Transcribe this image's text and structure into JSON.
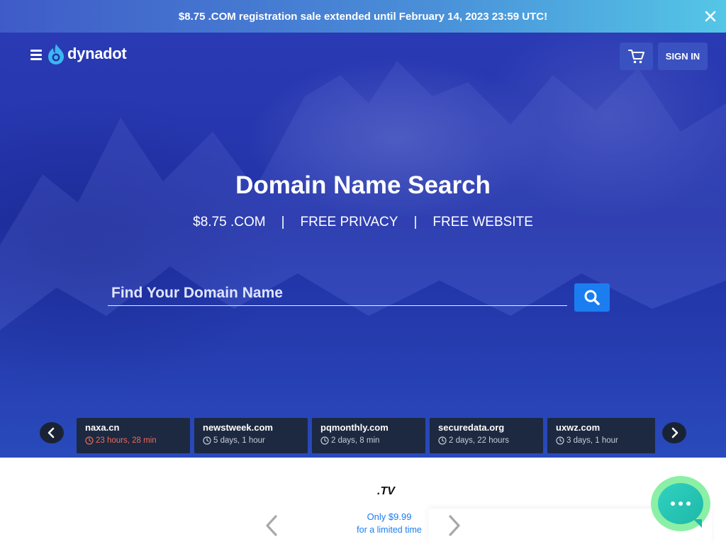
{
  "banner": {
    "text": "$8.75 .COM registration sale extended until February 14, 2023 23:59 UTC!"
  },
  "header": {
    "logo_text": "dynadot",
    "sign_in_label": "SIGN IN"
  },
  "hero": {
    "title": "Domain Name Search",
    "features": [
      "$8.75 .COM",
      "FREE PRIVACY",
      "FREE WEBSITE"
    ],
    "separator": "|",
    "search_placeholder": "Find Your Domain Name"
  },
  "auctions": [
    {
      "domain": "naxa.cn",
      "time": "23 hours, 28 min",
      "urgent": true
    },
    {
      "domain": "newstweek.com",
      "time": "5 days, 1 hour",
      "urgent": false
    },
    {
      "domain": "pqmonthly.com",
      "time": "2 days, 8 min",
      "urgent": false
    },
    {
      "domain": "securedata.org",
      "time": "2 days, 22 hours",
      "urgent": false
    },
    {
      "domain": "uxwz.com",
      "time": "3 days, 1 hour",
      "urgent": false
    }
  ],
  "promo": {
    "tld": ".TV",
    "line1": "Only $9.99",
    "line2": "for a limited time"
  },
  "colors": {
    "accent": "#1a7df0",
    "urgent": "#f06a5a",
    "card_bg": "#1c2940"
  },
  "icons": [
    "close-icon",
    "menu-icon",
    "cart-icon",
    "search-icon",
    "chevron-left-icon",
    "chevron-right-icon",
    "clock-icon",
    "chat-icon"
  ]
}
